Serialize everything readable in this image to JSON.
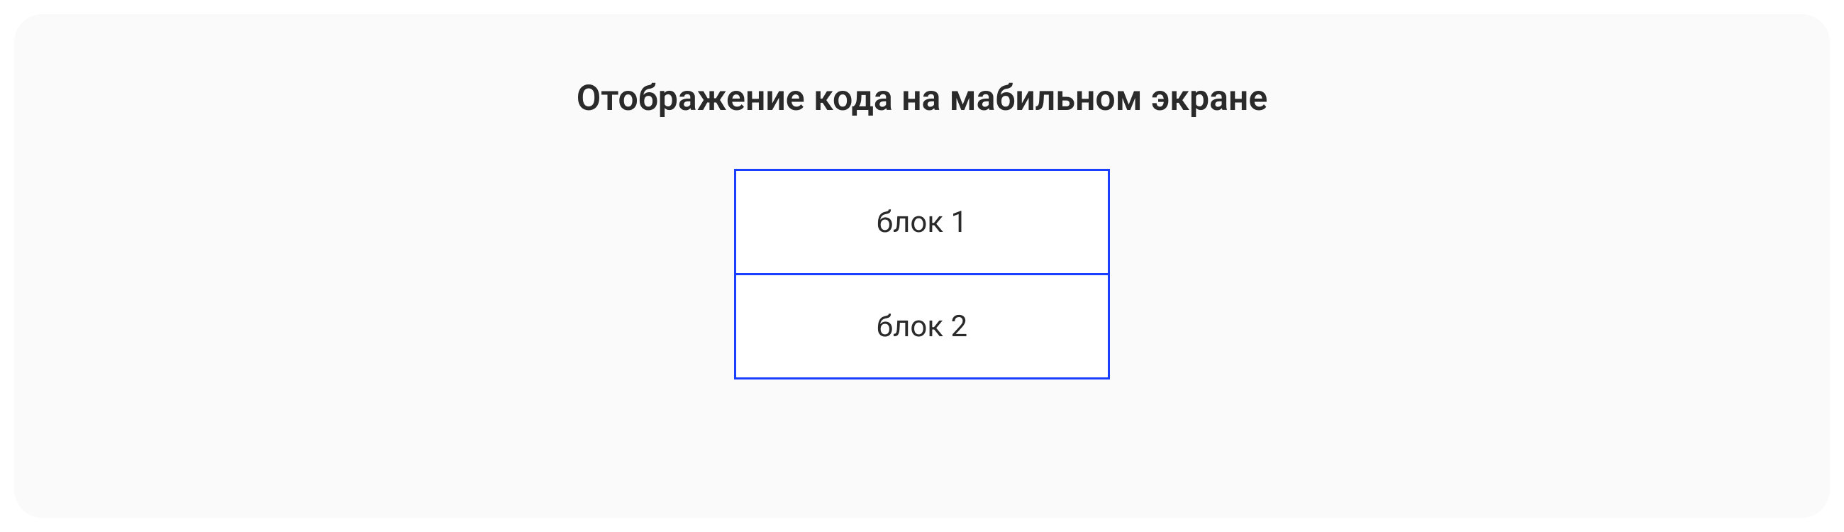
{
  "diagram": {
    "title": "Отображение кода на мабильном экране",
    "blocks": [
      {
        "label": "блок 1"
      },
      {
        "label": "блок 2"
      }
    ]
  }
}
